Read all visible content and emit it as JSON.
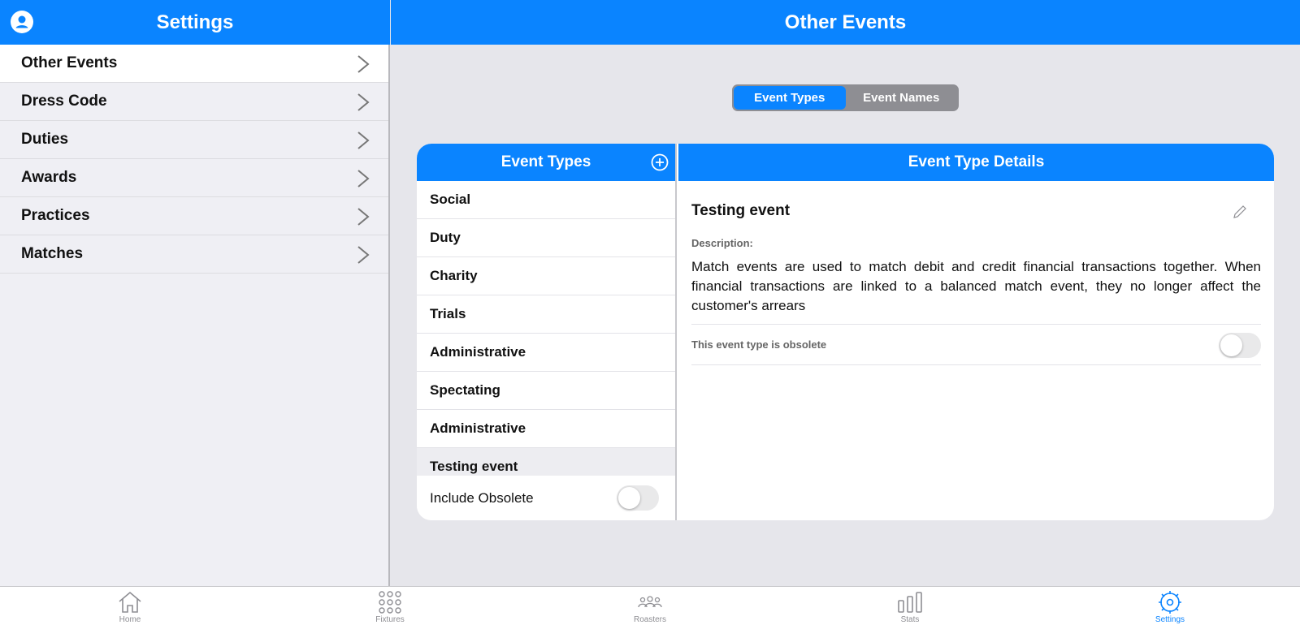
{
  "left_header": {
    "title": "Settings",
    "icon": "user-circle-icon"
  },
  "right_header": {
    "title": "Other Events"
  },
  "sidebar": {
    "items": [
      {
        "label": "Other Events",
        "active": true
      },
      {
        "label": "Dress Code"
      },
      {
        "label": "Duties"
      },
      {
        "label": "Awards"
      },
      {
        "label": "Practices"
      },
      {
        "label": "Matches"
      }
    ]
  },
  "segment": {
    "options": [
      "Event Types",
      "Event Names"
    ],
    "selected": "Event Types"
  },
  "types_panel": {
    "title": "Event Types",
    "items": [
      "Social",
      "Duty",
      "Charity",
      "Trials",
      "Administrative",
      "Spectating",
      "Administrative",
      "Testing event"
    ],
    "selected": "Testing event",
    "include_obsolete_label": "Include Obsolete",
    "include_obsolete": false
  },
  "details_panel": {
    "title": "Event Type Details",
    "event_name": "Testing event",
    "description_label": "Description:",
    "description": "Match events are used to match debit and credit financial transactions together. When financial transactions are linked to a balanced match event, they no longer affect the customer's arrears",
    "obsolete_label": "This event type is obsolete",
    "obsolete": false
  },
  "tabbar": {
    "tabs": [
      {
        "label": "Home",
        "icon": "home-icon"
      },
      {
        "label": "Fixtures",
        "icon": "grid-dots-icon"
      },
      {
        "label": "Roasters",
        "icon": "people-icon"
      },
      {
        "label": "Stats",
        "icon": "bar-chart-icon"
      },
      {
        "label": "Settings",
        "icon": "gear-icon",
        "active": true
      }
    ]
  },
  "colors": {
    "accent": "#0a84ff",
    "background": "#e6e6eb",
    "sidebar": "#efeff4"
  }
}
